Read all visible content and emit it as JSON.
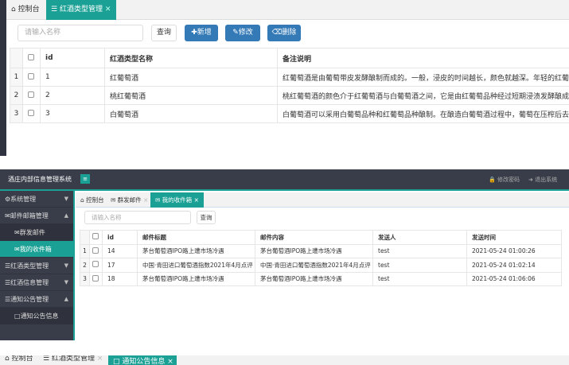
{
  "panel1": {
    "tabs": [
      {
        "icon": "home-icon",
        "label": "控制台"
      },
      {
        "icon": "list-icon",
        "label": "红酒类型管理"
      }
    ],
    "search_placeholder": "请输入名称",
    "query_label": "查询",
    "add_label": "新增",
    "edit_label": "修改",
    "delete_label": "删除",
    "columns": [
      "id",
      "红酒类型名称",
      "备注说明"
    ],
    "rows": [
      {
        "n": "1",
        "id": "1",
        "name": "红葡萄酒",
        "desc": "红葡萄酒是由葡萄带皮发酵酿制而成的。一般，浸皮的时间越长，颜色就越深。年轻的红葡萄"
      },
      {
        "n": "2",
        "id": "2",
        "name": "桃红葡萄酒",
        "desc": "桃红葡萄酒的颜色介于红葡萄酒与白葡萄酒之间，它是由红葡萄品种经过短期浸渍发酵酿成的"
      },
      {
        "n": "3",
        "id": "3",
        "name": "白葡萄酒",
        "desc": "白葡萄酒可以采用白葡萄品种和红葡萄品种酿制。在酿造白葡萄酒过程中，葡萄在压榨后去除"
      }
    ]
  },
  "panel2": {
    "app_title": "酒庄内部信息管理系统",
    "change_password": "修改密码",
    "logout": "退出系统",
    "sidebar": [
      {
        "label": "系统管理",
        "arrow": "▼",
        "type": "group"
      },
      {
        "label": "邮件邮箱管理",
        "arrow": "▲",
        "type": "group"
      },
      {
        "label": "群发邮件",
        "type": "sub"
      },
      {
        "label": "我的收件箱",
        "type": "sub-active"
      },
      {
        "label": "红酒类型管理",
        "arrow": "▼",
        "type": "group"
      },
      {
        "label": "红酒信息管理",
        "arrow": "▼",
        "type": "group"
      },
      {
        "label": "通知公告管理",
        "arrow": "▲",
        "type": "group"
      },
      {
        "label": "通知公告信息",
        "type": "sub"
      }
    ],
    "tabs": [
      {
        "label": "控制台"
      },
      {
        "label": "群发邮件"
      },
      {
        "label": "我的收件箱"
      }
    ],
    "search_placeholder": "请输入名称",
    "query_label": "查询",
    "columns": [
      "id",
      "邮件标题",
      "邮件内容",
      "发送人",
      "发送时间"
    ],
    "rows": [
      {
        "n": "1",
        "id": "14",
        "title": "茅台葡萄酒IPO路上遭市场冷遇",
        "content": "茅台葡萄酒IPO路上遭市场冷遇",
        "sender": "test",
        "time": "2021-05-24 01:00:26"
      },
      {
        "n": "2",
        "id": "17",
        "title": "中国·青田进口葡萄酒指数2021年4月点评",
        "content": "中国·青田进口葡萄酒指数2021年4月点评",
        "sender": "test",
        "time": "2021-05-24 01:02:14"
      },
      {
        "n": "3",
        "id": "18",
        "title": "茅台葡萄酒IPO路上遭市场冷遇",
        "content": "茅台葡萄酒IPO路上遭市场冷遇",
        "sender": "test",
        "time": "2021-05-24 01:06:06"
      }
    ]
  },
  "panel3": {
    "tabs": [
      {
        "label": "控制台"
      },
      {
        "label": "红酒类型管理"
      },
      {
        "label": "通知公告信息"
      }
    ]
  }
}
